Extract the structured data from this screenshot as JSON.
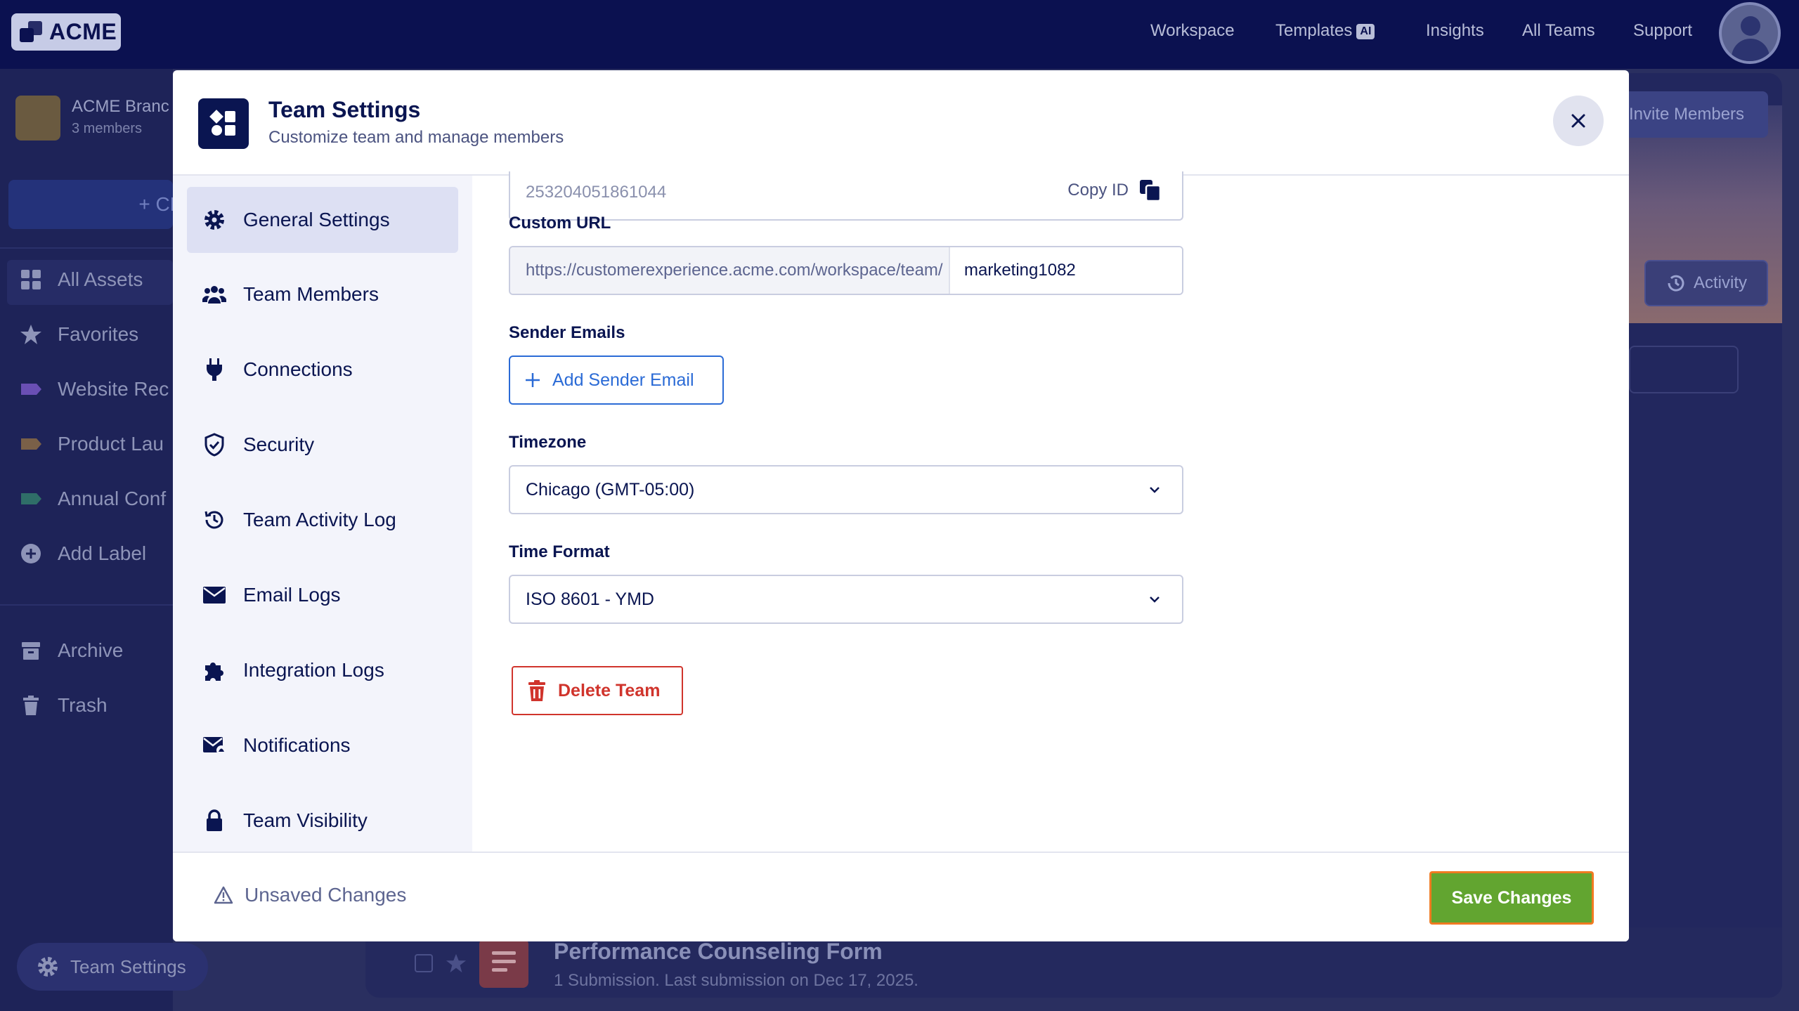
{
  "app": {
    "logo_text": "ACME",
    "topnav": [
      "Workspace",
      "Templates",
      "Insights",
      "All Teams",
      "Support"
    ],
    "templates_badge": "AI"
  },
  "sidebar": {
    "team_name": "ACME Branc",
    "team_members": "3 members",
    "create_label": "+ CR",
    "items": [
      {
        "label": "All Assets",
        "icon": "grid-icon"
      },
      {
        "label": "Favorites",
        "icon": "star-icon"
      },
      {
        "label": "Website Rec",
        "icon": "label-purple-icon"
      },
      {
        "label": "Product Lau",
        "icon": "label-brown-icon"
      },
      {
        "label": "Annual Conf",
        "icon": "label-teal-icon"
      },
      {
        "label": "Add Label",
        "icon": "plus-circle-icon"
      }
    ],
    "archive": "Archive",
    "trash": "Trash",
    "team_settings": "Team Settings"
  },
  "background": {
    "invite_label": "Invite Members",
    "activity_label": "Activity",
    "form_title": "Performance Counseling Form",
    "form_sub": "1 Submission.  Last submission on Dec 17, 2025."
  },
  "modal": {
    "title": "Team Settings",
    "subtitle": "Customize team and manage members",
    "nav": [
      {
        "label": "General Settings",
        "icon": "gear-icon"
      },
      {
        "label": "Team Members",
        "icon": "users-icon"
      },
      {
        "label": "Connections",
        "icon": "plug-icon"
      },
      {
        "label": "Security",
        "icon": "shield-icon"
      },
      {
        "label": "Team Activity Log",
        "icon": "history-icon"
      },
      {
        "label": "Email Logs",
        "icon": "envelope-icon"
      },
      {
        "label": "Integration Logs",
        "icon": "puzzle-icon"
      },
      {
        "label": "Notifications",
        "icon": "mail-notification-icon"
      },
      {
        "label": "Team Visibility",
        "icon": "lock-icon"
      }
    ],
    "team_id": "253204051861044",
    "copy_id_label": "Copy ID",
    "custom_url_label": "Custom URL",
    "url_prefix": "https://customerexperience.acme.com/workspace/team/",
    "url_slug": "marketing1082",
    "sender_emails_label": "Sender Emails",
    "add_sender_label": "Add Sender Email",
    "timezone_label": "Timezone",
    "timezone_value": "Chicago (GMT-05:00)",
    "time_format_label": "Time Format",
    "time_format_value": "ISO 8601 - YMD",
    "delete_label": "Delete Team",
    "unsaved_label": "Unsaved Changes",
    "save_label": "Save Changes"
  },
  "colors": {
    "navy": "#0a1551",
    "accent_blue": "#2b6bd6",
    "danger": "#d0342c",
    "save_green": "#62a530",
    "save_outline": "#f07a21"
  }
}
